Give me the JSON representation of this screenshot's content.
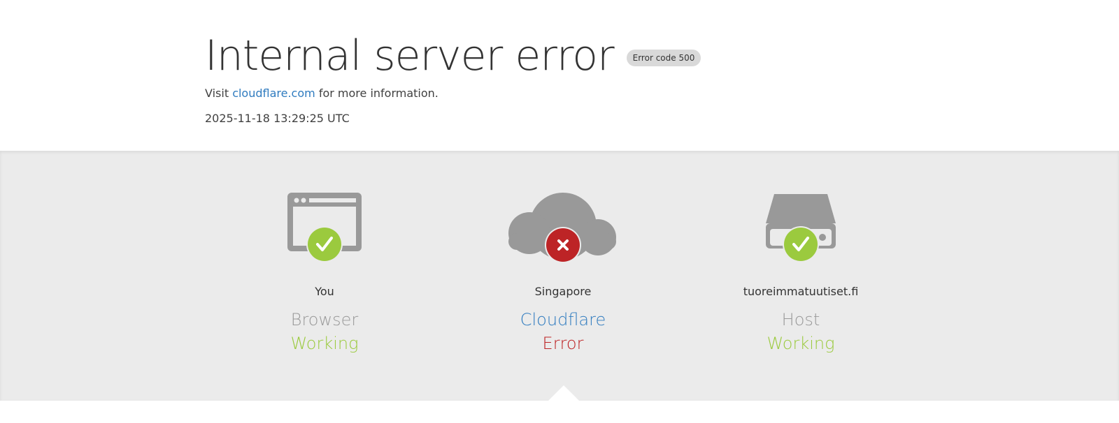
{
  "header": {
    "title": "Internal server error",
    "badge": "Error code 500",
    "info_prefix": "Visit ",
    "info_link": "cloudflare.com",
    "info_suffix": " for more information.",
    "timestamp": "2025-11-18 13:29:25 UTC"
  },
  "status": [
    {
      "location": "You",
      "name": "Browser",
      "state": "Working",
      "icon": "browser-icon",
      "result": "ok"
    },
    {
      "location": "Singapore",
      "name": "Cloudflare",
      "state": "Error",
      "icon": "cloud-icon",
      "result": "error"
    },
    {
      "location": "tuoreimmatuutiset.fi",
      "name": "Host",
      "state": "Working",
      "icon": "server-icon",
      "result": "ok"
    }
  ],
  "colors": {
    "ok": "#9bca3e",
    "error": "#bd2426",
    "link": "#2f7bbf",
    "icon_gray": "#999999"
  }
}
